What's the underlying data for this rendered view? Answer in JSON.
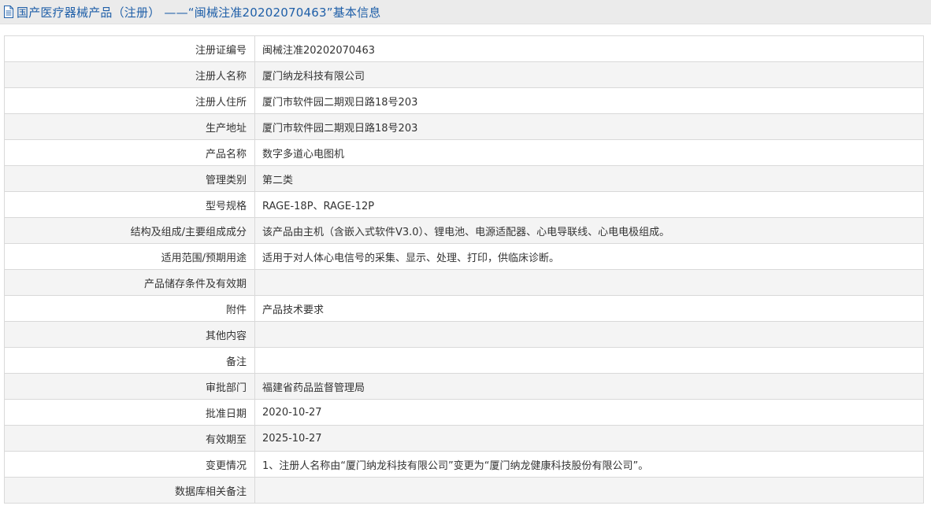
{
  "header": {
    "icon": "document-icon",
    "title": "国产医疗器械产品（注册） ——“闽械注准20202070463”基本信息"
  },
  "rows": [
    {
      "label": "注册证编号",
      "value": "闽械注准20202070463"
    },
    {
      "label": "注册人名称",
      "value": "厦门纳龙科技有限公司"
    },
    {
      "label": "注册人住所",
      "value": "厦门市软件园二期观日路18号203"
    },
    {
      "label": "生产地址",
      "value": "厦门市软件园二期观日路18号203"
    },
    {
      "label": "产品名称",
      "value": "数字多道心电图机"
    },
    {
      "label": "管理类别",
      "value": "第二类"
    },
    {
      "label": "型号规格",
      "value": "RAGE-18P、RAGE-12P"
    },
    {
      "label": "结构及组成/主要组成成分",
      "value": "该产品由主机（含嵌入式软件V3.0）、锂电池、电源适配器、心电导联线、心电电极组成。"
    },
    {
      "label": "适用范围/预期用途",
      "value": "适用于对人体心电信号的采集、显示、处理、打印，供临床诊断。"
    },
    {
      "label": "产品储存条件及有效期",
      "value": ""
    },
    {
      "label": "附件",
      "value": "产品技术要求"
    },
    {
      "label": "其他内容",
      "value": ""
    },
    {
      "label": "备注",
      "value": ""
    },
    {
      "label": "审批部门",
      "value": "福建省药品监督管理局"
    },
    {
      "label": "批准日期",
      "value": "2020-10-27"
    },
    {
      "label": "有效期至",
      "value": "2025-10-27"
    },
    {
      "label": "变更情况",
      "value": "1、注册人名称由“厦门纳龙科技有限公司”变更为“厦门纳龙健康科技股份有限公司”。"
    },
    {
      "label": "数据库相关备注",
      "value": ""
    }
  ]
}
